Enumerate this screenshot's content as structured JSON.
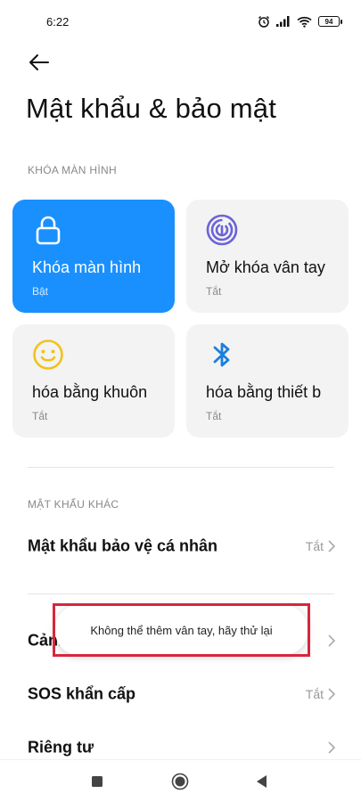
{
  "status_bar": {
    "time": "6:22",
    "battery": "94"
  },
  "page": {
    "title": "Mật khẩu & bảo mật"
  },
  "sections": {
    "screen_lock_header": "KHÓA MÀN HÌNH",
    "other_passwords_header": "MẬT KHẨU KHÁC"
  },
  "tiles": [
    {
      "title": "Khóa màn hình",
      "status": "Bật",
      "icon": "lock-icon",
      "active": true
    },
    {
      "title": "Mở khóa vân tay",
      "status": "Tắt",
      "icon": "fingerprint-icon",
      "active": false
    },
    {
      "title": "hóa bằng khuôn",
      "status": "Tắt",
      "icon": "face-icon",
      "active": false
    },
    {
      "title": "hóa bằng thiết b",
      "status": "Tắt",
      "icon": "bluetooth-icon",
      "active": false
    }
  ],
  "rows": [
    {
      "label": "Mật khẩu bảo vệ cá nhân",
      "value": "Tắt"
    },
    {
      "label": "Cảnh",
      "value": ""
    },
    {
      "label": "SOS khẩn cấp",
      "value": "Tắt"
    },
    {
      "label": "Riêng tư",
      "value": ""
    }
  ],
  "toast": {
    "message": "Không thể thêm vân tay, hãy thử lại"
  },
  "colors": {
    "accent": "#1a90ff",
    "tile_bg": "#f3f3f3",
    "fingerprint": "#6b63d9",
    "face": "#f2c21b",
    "bluetooth": "#1a7fe0",
    "highlight": "#d7263d"
  },
  "nav_bar": {
    "icons": [
      "recents-square-icon",
      "home-circle-icon",
      "back-triangle-icon"
    ]
  }
}
